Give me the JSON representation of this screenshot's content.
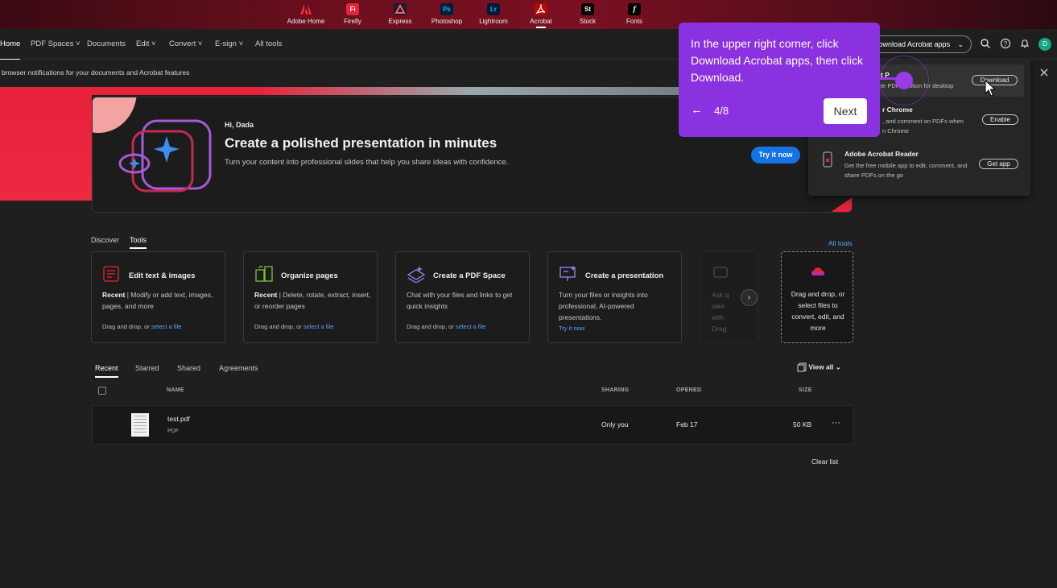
{
  "apps": [
    {
      "label": "Adobe Home",
      "icon": "adobe-icon",
      "glyph": "",
      "color": "#e8223a"
    },
    {
      "label": "Firefly",
      "icon": "firefly-icon",
      "glyph": "Fi",
      "color": "#e8223a"
    },
    {
      "label": "Express",
      "icon": "express-icon",
      "glyph": "",
      "color": "#1a1a40"
    },
    {
      "label": "Photoshop",
      "icon": "photoshop-icon",
      "glyph": "Ps",
      "color": "#001e36"
    },
    {
      "label": "Lightroom",
      "icon": "lightroom-icon",
      "glyph": "Lr",
      "color": "#001a33"
    },
    {
      "label": "Acrobat",
      "icon": "acrobat-icon",
      "glyph": "",
      "color": "#b30b00"
    },
    {
      "label": "Stock",
      "icon": "stock-icon",
      "glyph": "St",
      "color": "#000000"
    },
    {
      "label": "Fonts",
      "icon": "fonts-icon",
      "glyph": "f",
      "color": "#000000"
    }
  ],
  "nav": {
    "home": "Home",
    "pdf_spaces": "PDF Spaces",
    "documents": "Documents",
    "edit": "Edit",
    "convert": "Convert",
    "esign": "E-sign",
    "all_tools": "All tools",
    "download_apps": "Download Acrobat apps"
  },
  "notification": {
    "text": "browser notifications for your documents and Acrobat features"
  },
  "avatar_initial": "D",
  "hero": {
    "greeting": "Hi, Dada",
    "title": "Create a polished presentation in minutes",
    "subtitle": "Turn your content into professional slides that help you share ideas with confidence.",
    "cta": "Try it now"
  },
  "tool_tabs": {
    "discover": "Discover",
    "tools": "Tools",
    "all_tools_link": "All tools"
  },
  "cards": [
    {
      "title": "Edit text & images",
      "recent": "Recent",
      "desc": " | Modify or add text, images, pages, and more",
      "foot": "Drag and drop, or ",
      "link": "select a file"
    },
    {
      "title": "Organize pages",
      "recent": "Recent",
      "desc": " | Delete, rotate, extract, insert, or reorder pages",
      "foot": "Drag and drop, or ",
      "link": "select a file"
    },
    {
      "title": "Create a PDF Space",
      "desc": "Chat with your files and links to get quick insights",
      "foot": "Drag and drop, or ",
      "link": "select a file"
    },
    {
      "title": "Create a presentation",
      "desc": "Turn your files or insights into professional, AI-powered presentations.",
      "link": "Try it now"
    },
    {
      "desc": "Ask q take with Drag"
    }
  ],
  "drop_zone": {
    "text": "Drag and drop, or select files to convert, edit, and more"
  },
  "recent_tabs": {
    "recent": "Recent",
    "starred": "Starred",
    "shared": "Shared",
    "agreements": "Agreements",
    "view_all": "View all"
  },
  "table": {
    "headers": {
      "name": "NAME",
      "sharing": "SHARING",
      "opened": "OPENED",
      "size": "SIZE"
    },
    "rows": [
      {
        "name": "test.pdf",
        "type": "PDF",
        "sharing": "Only you",
        "opened": "Feb 17",
        "size": "50 KB"
      }
    ]
  },
  "clear_list": "Clear list",
  "popover": {
    "item1_title": "Acrobat for desktop",
    "item1_title_visible": "t P",
    "item1_desc": "te PDF solution for desktop",
    "item1_button": "Download",
    "item2_title": "r Chrome",
    "item2_desc_1": ", and comment on PDFs when",
    "item2_desc_2": "n Chrome",
    "item2_button": "Enable",
    "item3_title": "Adobe Acrobat Reader",
    "item3_desc_1": "Get the free mobile app to edit, comment, and",
    "item3_desc_2": "share PDFs on the go",
    "item3_button": "Get app"
  },
  "tour": {
    "text": "In the upper right corner, click Download Acrobat apps, then click Download.",
    "step": "4/8",
    "next": "Next",
    "back_glyph": "←"
  }
}
